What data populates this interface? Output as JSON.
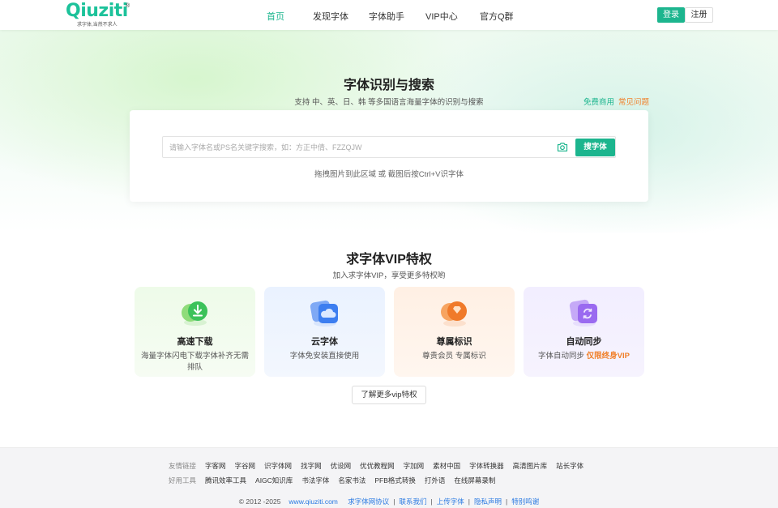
{
  "header": {
    "logo_text": "Qiuziti",
    "logo_tagline": "求字体,当然不求人",
    "logo_mark": "®",
    "nav": [
      {
        "label": "首页",
        "active": true
      },
      {
        "label": "发现字体",
        "active": false
      },
      {
        "label": "字体助手",
        "active": false
      },
      {
        "label": "VIP中心",
        "active": false
      },
      {
        "label": "官方Q群",
        "active": false
      }
    ],
    "login_label": "登录",
    "register_label": "注册"
  },
  "hero": {
    "title": "字体识别与搜索",
    "subtitle": "支持 中、英、日、韩 等多国语言海量字体的识别与搜索",
    "link_free": "免费商用",
    "link_faq": "常见问题",
    "search_placeholder": "请输入字体名或PS名关键字搜索，如：方正中倩、FZZQJW",
    "search_button": "搜字体",
    "hint": "拖拽图片到此区域 或 截图后按Ctrl+V识字体",
    "camera_icon": "camera-icon"
  },
  "vip": {
    "title": "求字体VIP特权",
    "subtitle": "加入求字体VIP，享受更多特权哟",
    "cards": [
      {
        "title": "高速下载",
        "desc": "海量字体闪电下载字体补齐无需排队",
        "highlight": "",
        "icon": "download-icon",
        "color": "#3cc25a"
      },
      {
        "title": "云字体",
        "desc": "字体免安装直接使用",
        "highlight": "",
        "icon": "cloud-icon",
        "color": "#3d7ef0"
      },
      {
        "title": "尊属标识",
        "desc": "尊贵会员 专属标识",
        "highlight": "",
        "icon": "diamond-icon",
        "color": "#f07a2a"
      },
      {
        "title": "自动同步",
        "desc": "字体自动同步",
        "highlight": "仅限终身VIP",
        "icon": "sync-icon",
        "color": "#9a6af0"
      }
    ],
    "more_button": "了解更多vip特权"
  },
  "footer": {
    "friends_label": "友情链接",
    "friends": [
      "字客网",
      "字谷网",
      "识字体网",
      "找字网",
      "优设网",
      "优优教程网",
      "字加网",
      "素材中国",
      "字体转换器",
      "高清图片库",
      "站长字体"
    ],
    "tools_label": "好用工具",
    "tools": [
      "腾讯效率工具",
      "AIGC知识库",
      "书法字体",
      "名家书法",
      "PFB格式转换",
      "打外语",
      "在线屏幕录制"
    ],
    "copyright": "© 2012 -2025",
    "site": "www.qiuziti.com",
    "links": [
      "求字体网协议",
      "联系我们",
      "上传字体",
      "隐私声明",
      "特别鸣谢"
    ]
  }
}
